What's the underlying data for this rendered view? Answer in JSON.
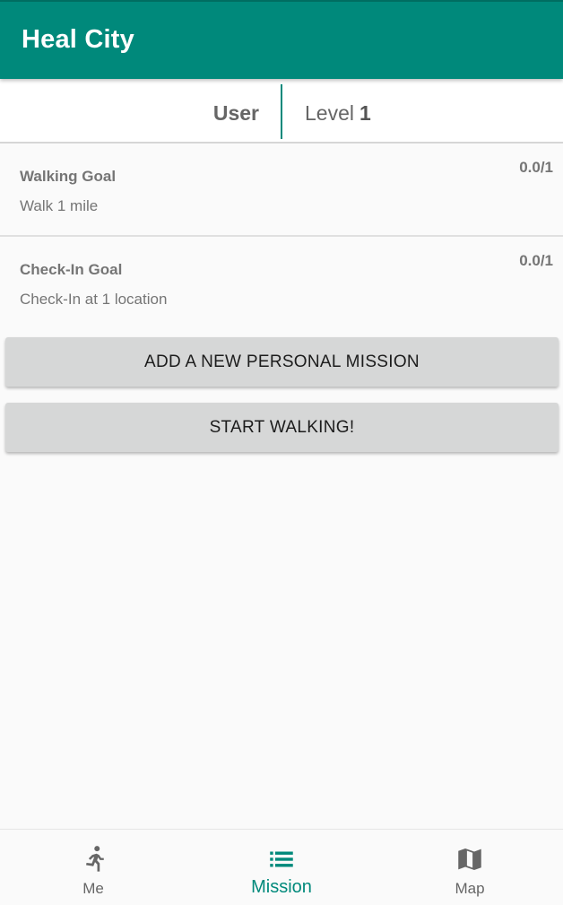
{
  "app": {
    "title": "Heal City"
  },
  "colors": {
    "primary": "#00897b",
    "active_nav": "#00897b",
    "inactive_nav": "#666666"
  },
  "user_strip": {
    "name": "User",
    "level_label": "Level",
    "level_value": "1"
  },
  "goals": [
    {
      "title": "Walking Goal",
      "description": "Walk 1 mile",
      "progress": "0.0/1"
    },
    {
      "title": "Check-In Goal",
      "description": "Check-In at 1 location",
      "progress": "0.0/1"
    }
  ],
  "buttons": {
    "add_mission": "ADD A NEW PERSONAL MISSION",
    "start_walking": "START WALKING!"
  },
  "bottom_nav": {
    "active": "Mission",
    "items": [
      {
        "label": "Me",
        "icon": "running-person-icon"
      },
      {
        "label": "Mission",
        "icon": "list-icon"
      },
      {
        "label": "Map",
        "icon": "map-icon"
      }
    ]
  }
}
